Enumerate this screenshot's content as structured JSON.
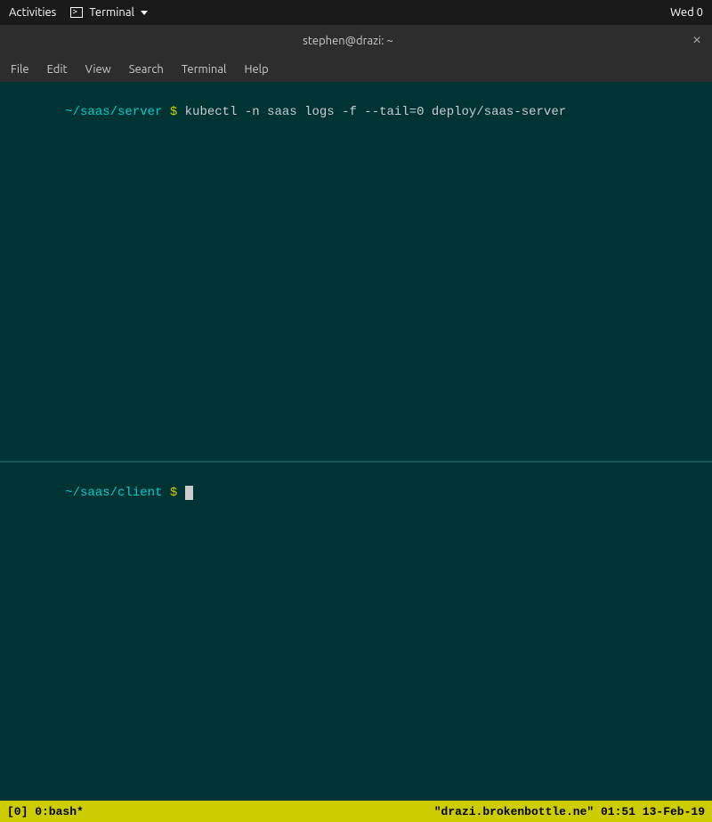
{
  "system_bar": {
    "activities_label": "Activities",
    "terminal_label": "Terminal",
    "clock": "Wed 0"
  },
  "title_bar": {
    "title": "stephen@drazi: ~",
    "close_label": "×"
  },
  "menu_bar": {
    "items": [
      {
        "label": "File"
      },
      {
        "label": "Edit"
      },
      {
        "label": "View"
      },
      {
        "label": "Search"
      },
      {
        "label": "Terminal"
      },
      {
        "label": "Help"
      }
    ]
  },
  "pane_top": {
    "prompt_dir": "~/saas/server",
    "prompt_dollar": "$",
    "command": "kubectl -n saas logs -f --tail=0 deploy/saas-server"
  },
  "pane_bottom": {
    "prompt_dir": "~/saas/client",
    "prompt_dollar": "$"
  },
  "status_bar": {
    "left": "[0] 0:bash*",
    "right": "\"drazi.brokenbottle.ne\" 01:51 13-Feb-19"
  }
}
